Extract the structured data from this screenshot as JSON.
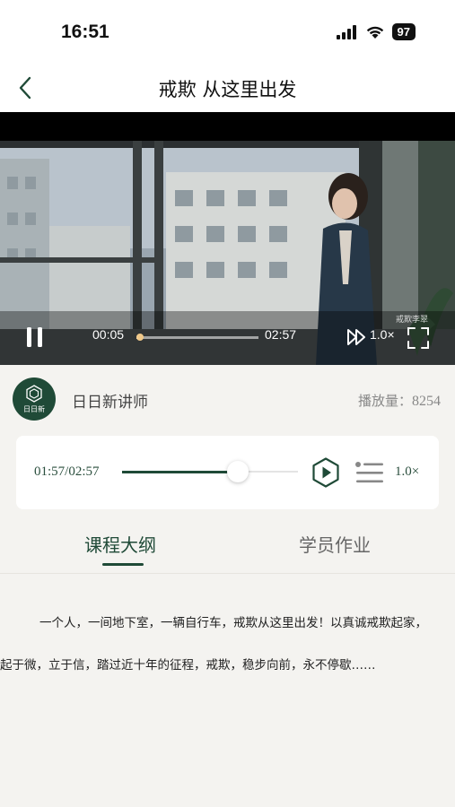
{
  "status_bar": {
    "time": "16:51",
    "battery": "97"
  },
  "nav": {
    "title": "戒欺 从这里出发"
  },
  "video": {
    "current_time": "00:05",
    "duration": "02:57",
    "progress": 0.03,
    "speed": "1.0×",
    "watermark": "戒欺李翠"
  },
  "teacher": {
    "name": "日日新讲师",
    "avatar_text": "日日新",
    "play_count_label": "播放量：",
    "play_count": "8254"
  },
  "audio": {
    "time": "01:57/02:57",
    "progress": 0.66,
    "speed": "1.0×"
  },
  "tabs": [
    {
      "label": "课程大纲",
      "active": true
    },
    {
      "label": "学员作业",
      "active": false
    }
  ],
  "intro": {
    "line1": "一个人，一间地下室，一辆自行车，戒欺从这里出发！以真诚戒欺起家，",
    "line2": "起于微，立于信，踏过近十年的征程，戒欺，稳步向前，永不停歇……"
  },
  "colors": {
    "brand": "#1f4a37",
    "accent": "#f0c98a"
  }
}
